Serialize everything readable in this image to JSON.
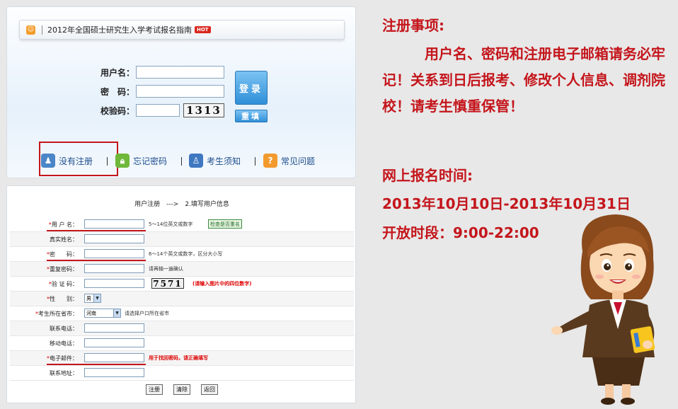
{
  "login": {
    "title": "2012年全国硕士研究生入学考试报名指南",
    "hot_badge": "HOT",
    "username_label": "用户名：",
    "password_label": "密　码：",
    "captcha_label": "校验码：",
    "captcha_value": "1313",
    "login_button": "登录",
    "reset_button": "重填",
    "nav": [
      {
        "label": "没有注册"
      },
      {
        "label": "忘记密码"
      },
      {
        "label": "考生须知"
      },
      {
        "label": "常见问题"
      }
    ]
  },
  "register": {
    "step_text": "用户注册　--->　2.填写用户信息",
    "rows": [
      {
        "label": "用 户 名：",
        "required": true,
        "hint": "5～14位英文或数字",
        "check_button": "检查是否重名"
      },
      {
        "label": "真实姓名：",
        "required": false,
        "hint": ""
      },
      {
        "label": "密　　码：",
        "required": true,
        "hint": "6～14个英文或数字，区分大小写"
      },
      {
        "label": "重复密码：",
        "required": true,
        "hint": "请再输一遍确认"
      },
      {
        "label": "验 证 码：",
        "required": true,
        "captcha": "7571",
        "hint": "(请输入图片中的四位数字)"
      },
      {
        "label": "性　　别：",
        "required": true,
        "select": "男"
      },
      {
        "label": "考生所在省市：",
        "required": true,
        "select": "河南",
        "hint": "请选择户口所在省市"
      },
      {
        "label": "联系电话：",
        "required": false,
        "hint": ""
      },
      {
        "label": "移动电话：",
        "required": false,
        "hint": ""
      },
      {
        "label": "电子邮件：",
        "required": true,
        "hint": "用于找回密码，请正确填写"
      },
      {
        "label": "联系地址：",
        "required": false,
        "hint": ""
      }
    ],
    "buttons": {
      "submit": "注册",
      "clear": "清除",
      "back": "返回"
    }
  },
  "notes": {
    "title": "注册事项:",
    "body": "　　　用户名、密码和注册电子邮箱请务必牢记！关系到日后报考、修改个人信息、调剂院校！请考生慎重保管！"
  },
  "schedule": {
    "title": "网上报名时间:",
    "range": "2013年10月10日-2013年10月31日",
    "hours": "开放时段：9:00-22:00"
  },
  "colors": {
    "accent_red": "#c4161c",
    "button_blue": "#2f8fd8"
  }
}
